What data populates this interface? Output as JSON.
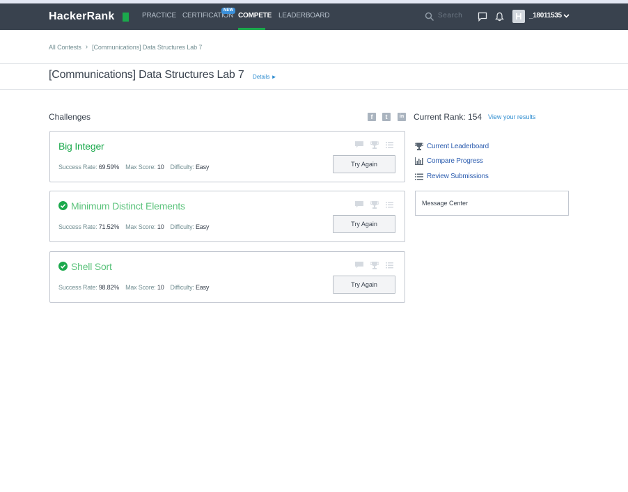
{
  "nav": {
    "logo": "HackerRank",
    "items": [
      "PRACTICE",
      "CERTIFICATION",
      "COMPETE",
      "LEADERBOARD"
    ],
    "new_badge": "NEW",
    "search_placeholder": "Search",
    "avatar_letter": "H",
    "username": "_18011535"
  },
  "breadcrumb": [
    "All Contests",
    "[Communications] Data Structures Lab 7"
  ],
  "page": {
    "title": "[Communications] Data Structures Lab 7",
    "details_link": "Details ►"
  },
  "challenges": {
    "heading": "Challenges",
    "items": [
      {
        "title": "Big Integer",
        "solved": false,
        "success_rate_label": "Success Rate:",
        "success_rate": "69.59%",
        "max_score_label": "Max Score:",
        "max_score": "10",
        "difficulty_label": "Difficulty:",
        "difficulty": "Easy",
        "button": "Try Again"
      },
      {
        "title": "Minimum Distinct Elements",
        "solved": true,
        "success_rate_label": "Success Rate:",
        "success_rate": "71.52%",
        "max_score_label": "Max Score:",
        "max_score": "10",
        "difficulty_label": "Difficulty:",
        "difficulty": "Easy",
        "button": "Try Again"
      },
      {
        "title": "Shell Sort",
        "solved": true,
        "success_rate_label": "Success Rate:",
        "success_rate": "98.82%",
        "max_score_label": "Max Score:",
        "max_score": "10",
        "difficulty_label": "Difficulty:",
        "difficulty": "Easy",
        "button": "Try Again"
      }
    ]
  },
  "share": {
    "icons": [
      "facebook-icon",
      "twitter-icon",
      "linkedin-icon"
    ],
    "letters": [
      "f",
      "t",
      "in"
    ]
  },
  "rank": {
    "text": "Current Rank: 154",
    "link": "View your results"
  },
  "sidebar": {
    "links": [
      "Current Leaderboard",
      "Compare Progress",
      "Review Submissions"
    ],
    "message_center": "Message Center"
  },
  "colors": {
    "navbar": "#39424e",
    "accent_green": "#1ba94c",
    "link_blue": "#2f8dd0"
  }
}
